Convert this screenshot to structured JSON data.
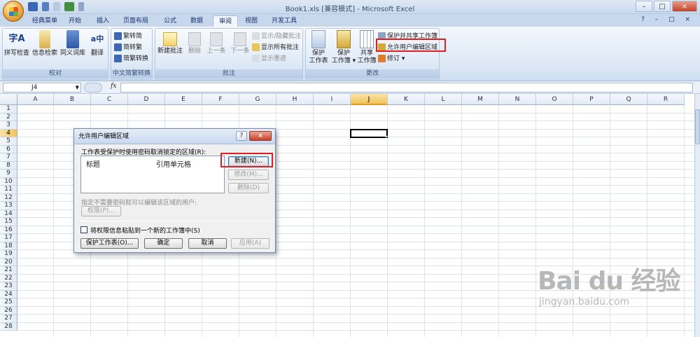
{
  "window": {
    "title": "Book1.xls  [兼容模式] - Microsoft Excel",
    "controls": [
      "–",
      "□",
      "×"
    ]
  },
  "tabs": [
    "经典菜单",
    "开始",
    "插入",
    "页面布局",
    "公式",
    "数据",
    "审阅",
    "视图",
    "开发工具"
  ],
  "active_tab": "审阅",
  "ribbon": {
    "proofing": {
      "label": "校对",
      "buttons": [
        "拼写检查",
        "信息检索",
        "同义词库",
        "翻译"
      ]
    },
    "chinese": {
      "label": "中文简繁转换",
      "buttons": [
        "繁转简",
        "简转繁",
        "简繁转换"
      ]
    },
    "comments": {
      "label": "批注",
      "buttons": [
        "新建批注",
        "删除",
        "上一条",
        "下一条"
      ],
      "small": [
        "显示/隐藏批注",
        "显示所有批注",
        "显示墨迹"
      ]
    },
    "changes": {
      "label": "更改",
      "buttons": [
        {
          "line1": "保护",
          "line2": "工作表"
        },
        {
          "line1": "保护",
          "line2": "工作簿 ▾"
        },
        {
          "line1": "共享",
          "line2": "工作簿"
        }
      ],
      "small": [
        "保护并共享工作簿",
        "允许用户编辑区域",
        "修订 ▾"
      ]
    }
  },
  "formula_bar": {
    "name_box": "J4",
    "fx": "fx",
    "value": ""
  },
  "columns": [
    "A",
    "B",
    "C",
    "D",
    "E",
    "F",
    "G",
    "H",
    "I",
    "J",
    "K",
    "L",
    "M",
    "N",
    "O",
    "P",
    "Q",
    "R"
  ],
  "selected_column": "J",
  "rows": [
    "1",
    "2",
    "3",
    "4",
    "5",
    "6",
    "7",
    "8",
    "9",
    "10",
    "11",
    "12",
    "13",
    "14",
    "15",
    "16",
    "17",
    "18",
    "19",
    "20",
    "21",
    "22",
    "23",
    "24",
    "25",
    "26",
    "27",
    "28"
  ],
  "selected_row": "4",
  "dialog": {
    "title": "允许用户编辑区域",
    "help": "?",
    "close": "×",
    "instruction": "工作表受保护时使用密码取消锁定的区域(R):",
    "list_headers": [
      "标题",
      "引用单元格"
    ],
    "btn_new": "新建(N)...",
    "btn_modify": "修改(M)...",
    "btn_delete": "删除(D)",
    "permission_text": "指定不需要密码就可以编辑该区域的用户:",
    "btn_permissions": "权限(P)...",
    "checkbox_label": "将权限信息粘贴到一个新的工作簿中(S)",
    "btn_protect": "保护工作表(O)...",
    "btn_ok": "确定",
    "btn_cancel": "取消",
    "btn_apply": "应用(A)"
  },
  "watermark": {
    "brand": "Bai du 经验",
    "url": "jingyan.baidu.com"
  },
  "colors": {
    "highlight": "#e21f1f",
    "ribbon": "#dde8f5",
    "selected_header": "#f3c35a"
  }
}
